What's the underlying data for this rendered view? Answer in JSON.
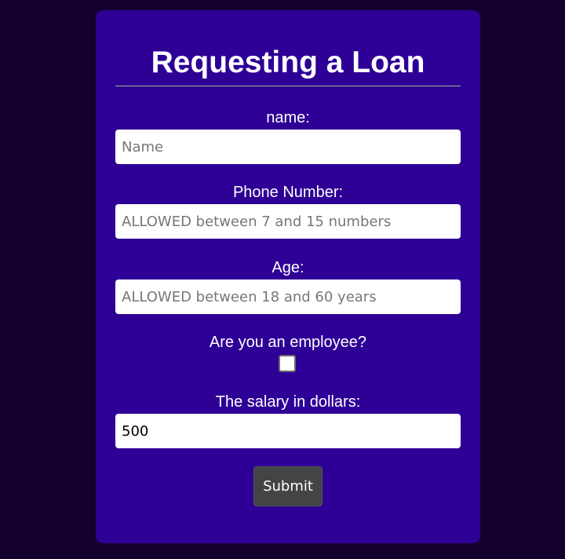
{
  "form": {
    "title": "Requesting a Loan",
    "name_label": "name:",
    "name_placeholder": "Name",
    "phone_label": "Phone Number:",
    "phone_placeholder": "ALLOWED between 7 and 15 numbers",
    "age_label": "Age:",
    "age_placeholder": "ALLOWED between 18 and 60 years",
    "employee_label": "Are you an employee?",
    "employee_checked": false,
    "salary_label": "The salary in dollars:",
    "salary_value": "500",
    "submit_label": "Submit"
  },
  "colors": {
    "page_background": "#14002e",
    "card_background": "#2e0096",
    "text": "#ffffff",
    "button_background": "#444444"
  }
}
